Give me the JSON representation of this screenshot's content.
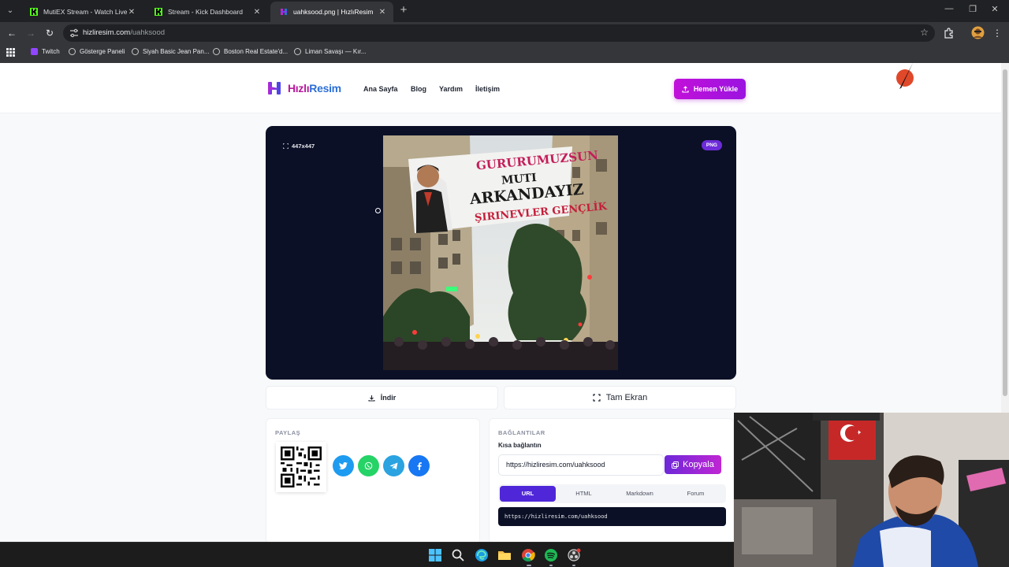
{
  "browser": {
    "tabs": [
      {
        "title": "MutiEX Stream - Watch Live on",
        "favicon": "kick-logo-icon",
        "active": false
      },
      {
        "title": "Stream - Kick Dashboard",
        "favicon": "kick-logo-icon",
        "active": false
      },
      {
        "title": "uahksood.png | HızlıResim",
        "favicon": "hizliresim-logo-icon",
        "active": true
      }
    ],
    "url_host": "hizliresim.com",
    "url_path": "/uahksood",
    "bookmarks": [
      "Twitch",
      "Gösterge Paneli",
      "Siyah Basic Jean Pan...",
      "Boston Real Estate'd...",
      "Liman Savaşı — Kır..."
    ]
  },
  "site": {
    "logo_prefix": "Hızlı",
    "logo_suffix": "Resim",
    "nav": [
      "Ana Sayfa",
      "Blog",
      "Yardım",
      "İletişim"
    ],
    "upload_label": "Hemen Yükle"
  },
  "viewer": {
    "dimensions": "447x447",
    "format": "PNG",
    "banner_lines": [
      "GURURUMUZSUN",
      "MUTI",
      "ARKANDAYIZ",
      "ŞIRINEVLER GENÇLİK"
    ]
  },
  "actions": {
    "download_label": "İndir",
    "fullscreen_label": "Tam Ekran"
  },
  "share": {
    "title": "PAYLAŞ",
    "buttons": [
      {
        "name": "twitter",
        "color": "#1d9bf0"
      },
      {
        "name": "whatsapp",
        "color": "#25d366"
      },
      {
        "name": "telegram",
        "color": "#2aa3e0"
      },
      {
        "name": "facebook",
        "color": "#1877f2"
      }
    ]
  },
  "links": {
    "title": "BAĞLANTILAR",
    "short_label": "Kısa bağlantın",
    "short_url": "https://hizliresim.com/uahksood",
    "copy_label": "Kopyala",
    "tabs": [
      "URL",
      "HTML",
      "Markdown",
      "Forum"
    ],
    "active_tab": "URL",
    "code": "https://hizliresim.com/uahksood"
  },
  "colors": {
    "accent_purple": "#9b12e0",
    "viewer_bg": "#0b1026",
    "logo_blue": "#2b6fd6",
    "logo_magenta": "#b8189c"
  }
}
